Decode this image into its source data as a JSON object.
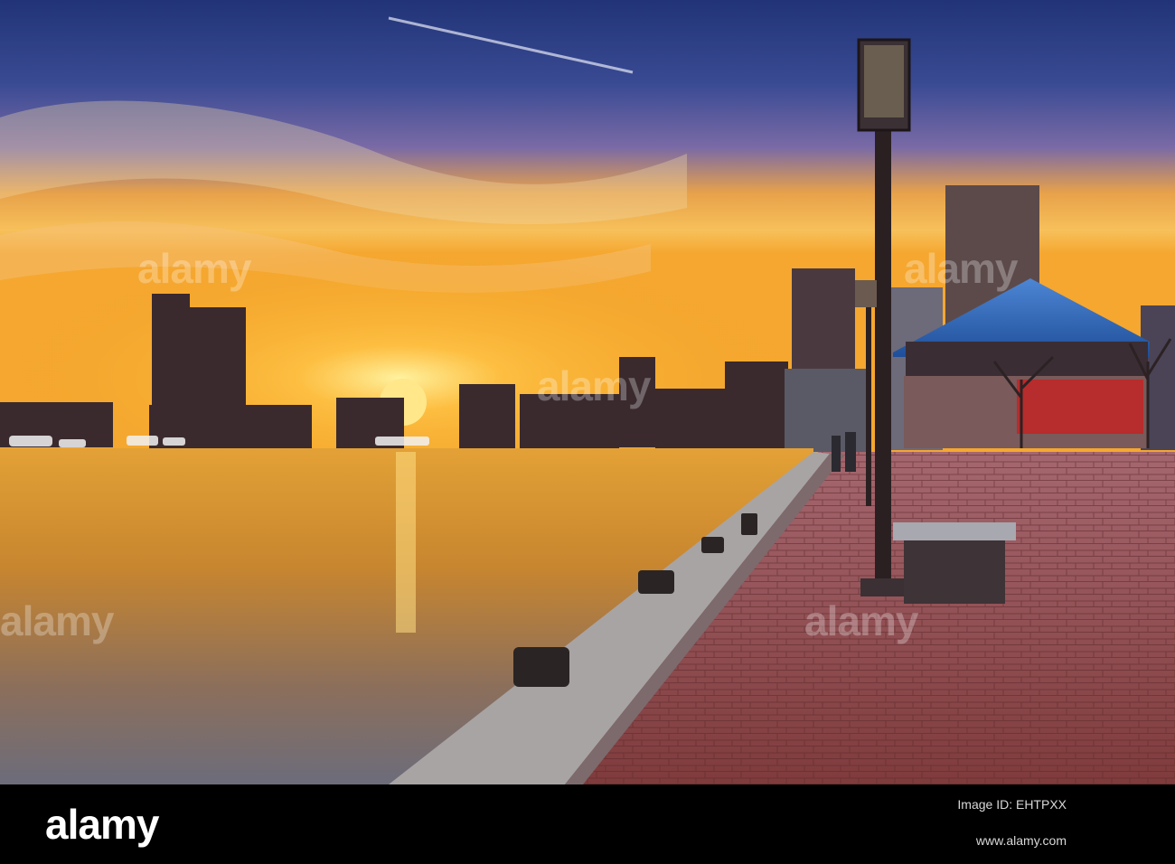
{
  "photo": {
    "palette": {
      "sky_top": "#2c3f86",
      "sky_mid": "#6b5f9e",
      "sky_glow": "#f2a23a",
      "sun": "#ffe27a",
      "water": "#d28a2c",
      "brick": "#9a4b4f",
      "dome": "#2b63b8"
    }
  },
  "watermark": {
    "logo": "alamy",
    "id_label": "Image ID: EHTPXX",
    "url": "www.alamy.com",
    "id": ""
  }
}
